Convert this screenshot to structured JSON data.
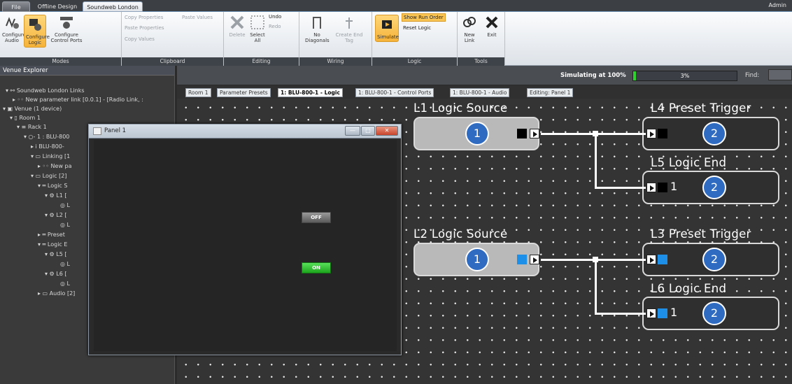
{
  "tabs": {
    "file": "File",
    "offline": "Offline Design",
    "active": "Soundweb London"
  },
  "user": "Admin",
  "ribbon": {
    "modes": {
      "label": "Modes",
      "configure_audio": "Configure Audio",
      "configure_logic": "Configure Logic",
      "configure_control_ports": "Configure Control Ports"
    },
    "clipboard": {
      "label": "Clipboard",
      "copy_properties": "Copy Properties",
      "paste_values": "Paste Values",
      "paste_properties": "Paste Properties",
      "copy_values": "Copy Values"
    },
    "editing": {
      "label": "Editing",
      "delete": "Delete",
      "select_all": "Select All",
      "undo": "Undo",
      "redo": "Redo"
    },
    "wiring": {
      "label": "Wiring",
      "no_diagonals": "No Diagonals",
      "create_end_tag": "Create End Tag"
    },
    "logic": {
      "label": "Logic",
      "simulate": "Simulate",
      "show_run_order": "Show Run Order",
      "reset_logic": "Reset Logic"
    },
    "tools": {
      "label": "Tools",
      "new_link": "New Link",
      "exit": "Exit"
    }
  },
  "venue_explorer": {
    "title": "Venue Explorer",
    "items": [
      "Soundweb London Links",
      "New parameter link  [0.0.1]  -  [Radio Link, :",
      "Venue (1 device)",
      "Room 1",
      "Rack 1",
      "1 : BLU-800",
      "BLU-800-",
      "Linking [1",
      "New pa",
      "Logic [2]",
      "Logic S",
      "L1 [",
      "L",
      "L2 [",
      "L",
      "Preset",
      "Logic E",
      "L5 [",
      "L",
      "L6 [",
      "L",
      "Audio [2]"
    ]
  },
  "status": {
    "simulating": "Simulating at 100%",
    "progress_text": "3%",
    "progress": 0.03,
    "find_label": "Find:"
  },
  "doc_tabs": [
    "Room 1",
    "Parameter Presets",
    "1: BLU-800-1 - Logic",
    "1: BLU-800-1 - Control Ports",
    "1: BLU-800-1 - Audio",
    "Editing: Panel 1"
  ],
  "blocks": {
    "l1": {
      "title": "L1  Logic Source",
      "num": "1"
    },
    "l4": {
      "title": "L4  Preset Trigger",
      "num": "2"
    },
    "l5": {
      "title": "L5  Logic End",
      "num": "2",
      "value": "1"
    },
    "l2": {
      "title": "L2  Logic Source",
      "num": "1"
    },
    "l3": {
      "title": "L3  Preset Trigger",
      "num": "2"
    },
    "l6": {
      "title": "L6  Logic End",
      "num": "2",
      "value": "1"
    }
  },
  "panel": {
    "title": "Panel 1",
    "btn_off": "OFF",
    "btn_on": "ON",
    "close": "✕",
    "min": "—",
    "max": "□"
  },
  "colors": {
    "active_black": "#000000",
    "active_blue": "#1e8fe8",
    "accent": "#2f6bc0"
  }
}
